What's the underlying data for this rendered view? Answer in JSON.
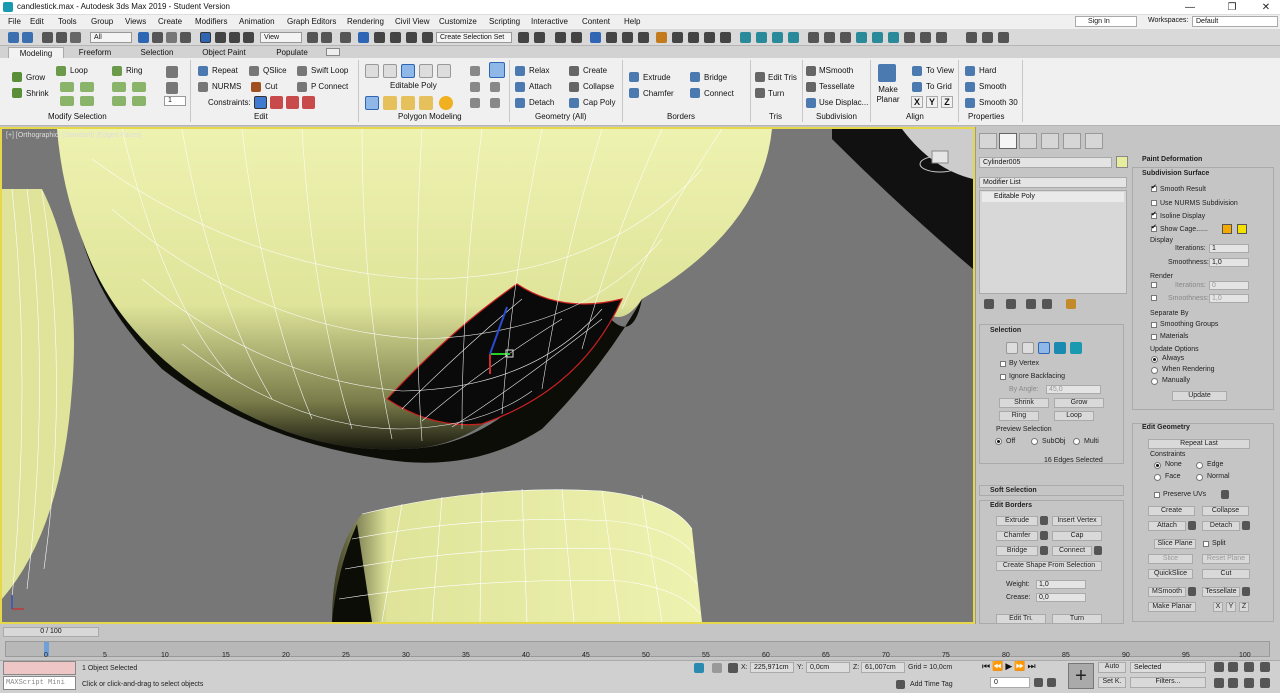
{
  "window": {
    "title": "candlestick.max - Autodesk 3ds Max 2019 - Student Version",
    "min": "—",
    "max": "❐",
    "close": "✕"
  },
  "menu": [
    "File",
    "Edit",
    "Tools",
    "Group",
    "Views",
    "Create",
    "Modifiers",
    "Animation",
    "Graph Editors",
    "Rendering",
    "Civil View",
    "Customize",
    "Scripting",
    "Interactive",
    "Content",
    "Help"
  ],
  "account": {
    "signin": "Sign In",
    "workspaces_label": "Workspaces:",
    "workspace": "Default"
  },
  "toolbar": {
    "filter": "All",
    "refcoord": "View",
    "selset": "Create Selection Set"
  },
  "ribbon_tabs": [
    "Modeling",
    "Freeform",
    "Selection",
    "Object Paint",
    "Populate"
  ],
  "ribbon": {
    "modify_selection": {
      "grow": "Grow",
      "shrink": "Shrink",
      "loop": "Loop",
      "ring": "Ring",
      "spin_value": "1",
      "title": "Modify Selection"
    },
    "edit": {
      "repeat": "Repeat",
      "qslice": "QSlice",
      "swift_loop": "Swift Loop",
      "nurms": "NURMS",
      "cut": "Cut",
      "pconnect": "P Connect",
      "constraints": "Constraints:",
      "title": "Edit"
    },
    "polygon_modeling": {
      "label": "Editable Poly",
      "title": "Polygon Modeling"
    },
    "geometry": {
      "relax": "Relax",
      "create": "Create",
      "attach": "Attach",
      "collapse": "Collapse",
      "detach": "Detach",
      "cap_poly": "Cap Poly",
      "title": "Geometry (All)"
    },
    "borders": {
      "extrude": "Extrude",
      "bridge": "Bridge",
      "chamfer": "Chamfer",
      "connect": "Connect",
      "title": "Borders"
    },
    "tris": {
      "edit_tris": "Edit Tris",
      "turn": "Turn",
      "title": "Tris"
    },
    "subdivision": {
      "msmooth": "MSmooth",
      "tessellate": "Tessellate",
      "use_displac": "Use Displac...",
      "title": "Subdivision"
    },
    "align": {
      "make_planar": "Make Planar",
      "to_view": "To View",
      "to_grid": "To Grid",
      "x": "X",
      "y": "Y",
      "z": "Z",
      "title": "Align"
    },
    "properties": {
      "hard": "Hard",
      "smooth": "Smooth",
      "smooth30": "Smooth 30",
      "title": "Properties"
    }
  },
  "viewport": {
    "label": "[+] [Orthographic] [Standard] [Edged Faces]"
  },
  "cmd": {
    "object_name": "Cylinder005",
    "modifier_list": "Modifier List",
    "stack_item": "Editable Poly",
    "selection": {
      "title": "Selection",
      "by_vertex": "By Vertex",
      "ignore_backfacing": "Ignore Backfacing",
      "by_angle": "By Angle:",
      "angle": "45,0",
      "shrink": "Shrink",
      "grow": "Grow",
      "ring": "Ring",
      "loop": "Loop",
      "preview": "Preview Selection",
      "off": "Off",
      "subobj": "SubObj",
      "multi": "Multi",
      "status": "16 Edges Selected"
    },
    "soft_selection": "Soft Selection",
    "edit_borders": {
      "title": "Edit Borders",
      "extrude": "Extrude",
      "insert_vertex": "Insert Vertex",
      "chamfer": "Chamfer",
      "cap": "Cap",
      "bridge": "Bridge",
      "connect": "Connect",
      "create_shape": "Create Shape From Selection",
      "weight_label": "Weight:",
      "weight": "1,0",
      "crease_label": "Crease:",
      "crease": "0,0",
      "edit_tri": "Edit Tri.",
      "turn": "Turn"
    },
    "paint_deformation": "Paint Deformation",
    "subdivision": {
      "title": "Subdivision Surface",
      "smooth_result": "Smooth Result",
      "use_nurms": "Use NURMS Subdivision",
      "isoline": "Isoline Display",
      "show_cage": "Show Cage......",
      "display": "Display",
      "iterations": "Iterations:",
      "iter_val": "1",
      "smoothness": "Smoothness:",
      "smooth_val": "1,0",
      "render": "Render",
      "r_iter_val": "0",
      "r_smooth_val": "1,0",
      "separate_by": "Separate By",
      "smoothing_groups": "Smoothing Groups",
      "materials": "Materials",
      "update_options": "Update Options",
      "always": "Always",
      "when_rendering": "When Rendering",
      "manually": "Manually",
      "update": "Update"
    },
    "edit_geometry": {
      "title": "Edit Geometry",
      "repeat_last": "Repeat Last",
      "constraints": "Constraints",
      "none": "None",
      "edge": "Edge",
      "face": "Face",
      "normal": "Normal",
      "preserve_uvs": "Preserve UVs",
      "create": "Create",
      "collapse": "Collapse",
      "attach": "Attach",
      "detach": "Detach",
      "slice_plane": "Slice Plane",
      "split": "Split",
      "slice": "Slice",
      "reset_plane": "Reset Plane",
      "quickslice": "QuickSlice",
      "cut": "Cut",
      "msmooth": "MSmooth",
      "tessellate": "Tessellate",
      "make_planar": "Make Planar",
      "x": "X",
      "y": "Y",
      "z": "Z"
    }
  },
  "timeline": {
    "slider": "0 / 100",
    "ticks": [
      "0",
      "5",
      "10",
      "15",
      "20",
      "25",
      "30",
      "35",
      "40",
      "45",
      "50",
      "55",
      "60",
      "65",
      "70",
      "75",
      "80",
      "85",
      "90",
      "95",
      "100"
    ]
  },
  "status": {
    "maxscript": "MAXScript Mini",
    "objects": "1 Object Selected",
    "prompt": "Click or click-and-drag to select objects",
    "x_label": "X:",
    "x": "225,971cm",
    "y_label": "Y:",
    "y": "0,0cm",
    "z_label": "Z:",
    "z": "61,007cm",
    "grid": "Grid = 10,0cm",
    "add_time_tag": "Add Time Tag",
    "frame": "0",
    "auto": "Auto",
    "setk": "Set K.",
    "selected": "Selected",
    "filters": "Filters..."
  },
  "colors": {
    "mesh": "#e0e59a",
    "viewport_border": "#e6d84a",
    "selection_edge": "#cc2020",
    "cage1": "#f5a800",
    "cage2": "#f5e000"
  }
}
